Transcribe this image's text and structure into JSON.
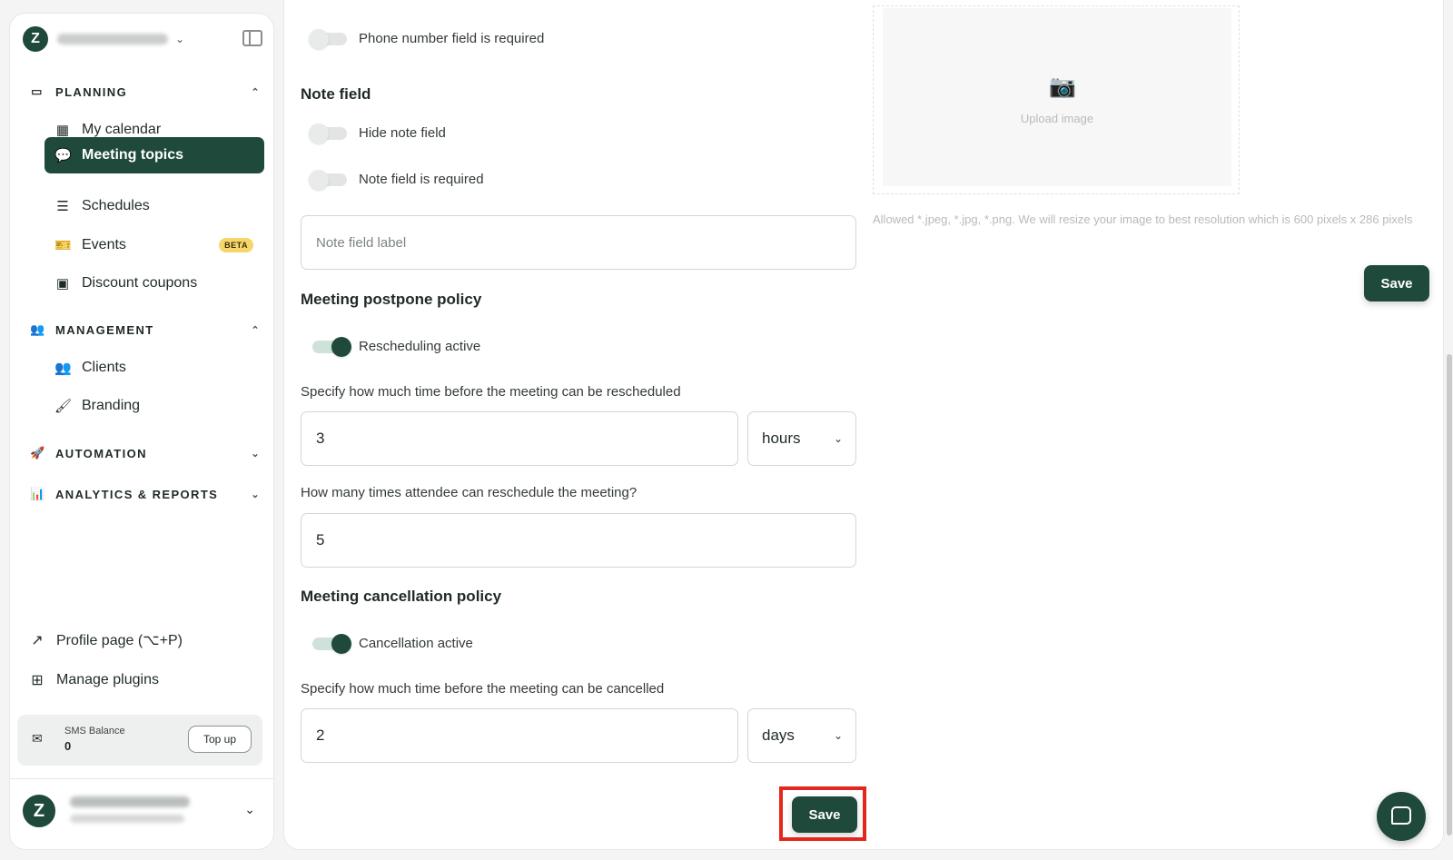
{
  "sidebar": {
    "sections": {
      "planning": "PLANNING",
      "management": "MANAGEMENT",
      "automation": "AUTOMATION",
      "analytics": "ANALYTICS & REPORTS"
    },
    "items": [
      {
        "label": "My calendar"
      },
      {
        "label": "Meeting topics"
      },
      {
        "label": "Schedules"
      },
      {
        "label": "Events",
        "badge": "BETA"
      },
      {
        "label": "Discount coupons"
      },
      {
        "label": "Clients"
      },
      {
        "label": "Branding"
      }
    ],
    "profile_page": "Profile page (⌥+P)",
    "manage_plugins": "Manage plugins",
    "sms": {
      "label": "SMS Balance",
      "value": "0",
      "topup": "Top up"
    }
  },
  "form": {
    "phone_required": "Phone number field is required",
    "note_section": "Note field",
    "hide_note": "Hide note field",
    "note_required": "Note field is required",
    "note_label_placeholder": "Note field label",
    "postpone_section": "Meeting postpone policy",
    "rescheduling_active": "Rescheduling active",
    "reschedule_question": "Specify how much time before the meeting can be rescheduled",
    "reschedule_value": "3",
    "reschedule_unit": "hours",
    "times_question": "How many times attendee can reschedule the meeting?",
    "times_value": "5",
    "cancel_section": "Meeting cancellation policy",
    "cancellation_active": "Cancellation active",
    "cancel_question": "Specify how much time before the meeting can be cancelled",
    "cancel_value": "2",
    "cancel_unit": "days",
    "save_label": "Save"
  },
  "upload": {
    "text": "Upload image",
    "allowed": "Allowed *.jpeg, *.jpg, *.png. We will resize your image to best resolution which is 600 pixels x 286 pixels",
    "save_label": "Save"
  },
  "colors": {
    "brand": "#1f4a3b",
    "highlight": "#e5261d",
    "beta": "#f6d56b"
  }
}
